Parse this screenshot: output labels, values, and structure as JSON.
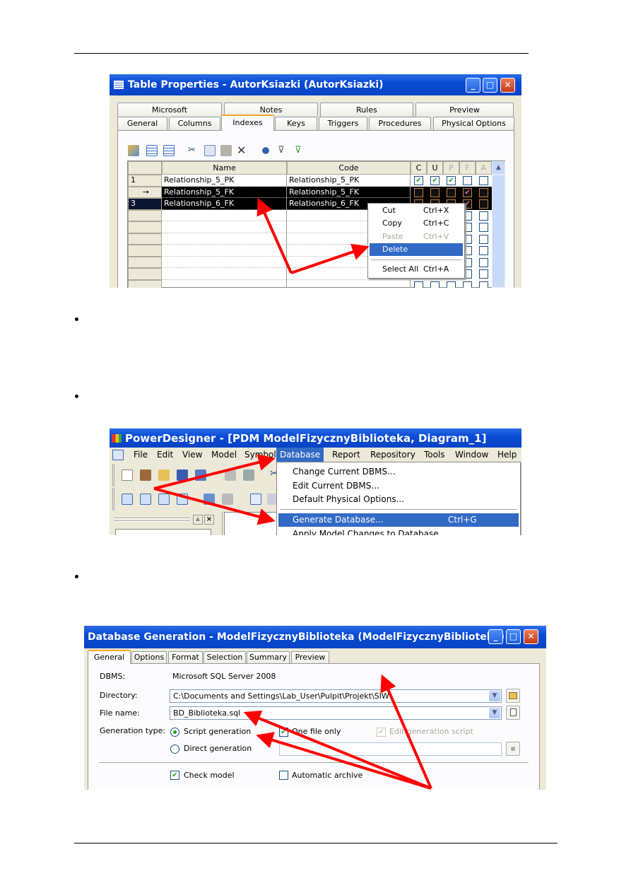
{
  "shot1": {
    "title": "Table Properties - AutorKsiazki (AutorKsiazki)",
    "tabs_row1": [
      "Microsoft",
      "Notes",
      "Rules",
      "Preview"
    ],
    "tabs_row2": [
      "General",
      "Columns",
      "Indexes",
      "Keys",
      "Triggers",
      "Procedures",
      "Physical Options"
    ],
    "selected_tab": "Indexes",
    "toolbar_icons": [
      "properties-icon",
      "insert-row-icon",
      "add-row-icon",
      "cut-icon",
      "copy-icon",
      "paste-icon",
      "delete-icon",
      "find-icon",
      "filter-icon",
      "filter-check-icon"
    ],
    "grid": {
      "headers": {
        "name": "Name",
        "code": "Code",
        "c": "C",
        "u": "U",
        "p": "P",
        "f": "F",
        "a": "A"
      },
      "rows": [
        {
          "num": "1",
          "name": "Relationship_5_PK",
          "code": "Relationship_5_PK",
          "flags": [
            true,
            true,
            true,
            false,
            false
          ],
          "selected": false
        },
        {
          "num": "→",
          "name": "Relationship_5_FK",
          "code": "Relationship_5_FK",
          "flags": [
            false,
            false,
            false,
            true,
            false
          ],
          "selected": true
        },
        {
          "num": "3",
          "name": "Relationship_6_FK",
          "code": "Relationship_6_FK",
          "flags": [
            false,
            false,
            false,
            true,
            false
          ],
          "selected": true
        }
      ]
    },
    "context_menu": [
      {
        "label": "Cut",
        "shortcut": "Ctrl+X"
      },
      {
        "label": "Copy",
        "shortcut": "Ctrl+C"
      },
      {
        "label": "Paste",
        "shortcut": "Ctrl+V",
        "disabled": true
      },
      {
        "label": "Delete",
        "shortcut": "",
        "highlighted": true
      },
      {
        "label": "Select All",
        "shortcut": "Ctrl+A"
      }
    ]
  },
  "shot2": {
    "title": "PowerDesigner - [PDM ModelFizycznyBiblioteka, Diagram_1]",
    "menubar": [
      "File",
      "Edit",
      "View",
      "Model",
      "Symbol",
      "Database",
      "Report",
      "Repository",
      "Tools",
      "Window",
      "Help"
    ],
    "active_menu": "Database",
    "dropdown": [
      {
        "label": "Change Current DBMS...",
        "shortcut": ""
      },
      {
        "label": "Edit Current DBMS...",
        "shortcut": ""
      },
      {
        "label": "Default Physical Options...",
        "shortcut": ""
      },
      {
        "label": "Generate Database...",
        "shortcut": "Ctrl+G",
        "highlighted": true
      },
      {
        "label": "Apply Model Changes to Database...",
        "shortcut": ""
      }
    ]
  },
  "shot3": {
    "title": "Database Generation - ModelFizycznyBiblioteka (ModelFizycznyBiblioteka)",
    "tabs": [
      "General",
      "Options",
      "Format",
      "Selection",
      "Summary",
      "Preview"
    ],
    "selected_tab": "General",
    "dbms_label": "DBMS:",
    "dbms_value": "Microsoft SQL Server 2008",
    "directory_label": "Directory:",
    "directory_value": "C:\\Documents and Settings\\Lab_User\\Pulpit\\Projekt\\SIW\\",
    "filename_label": "File name:",
    "filename_value": "BD_Biblioteka.sql",
    "gentype_label": "Generation type:",
    "script_generation": "Script generation",
    "direct_generation": "Direct generation",
    "selected_generation": "Script generation",
    "one_file_only": "One file only",
    "one_file_only_checked": true,
    "edit_script": "Edit generation script",
    "edit_script_checked": true,
    "check_model": "Check model",
    "check_model_checked": true,
    "automatic_archive": "Automatic archive",
    "automatic_archive_checked": false
  },
  "colors": {
    "arrow": "#ff0000",
    "highlight": "#316ac5",
    "titlebar": "#0a4bd6"
  }
}
